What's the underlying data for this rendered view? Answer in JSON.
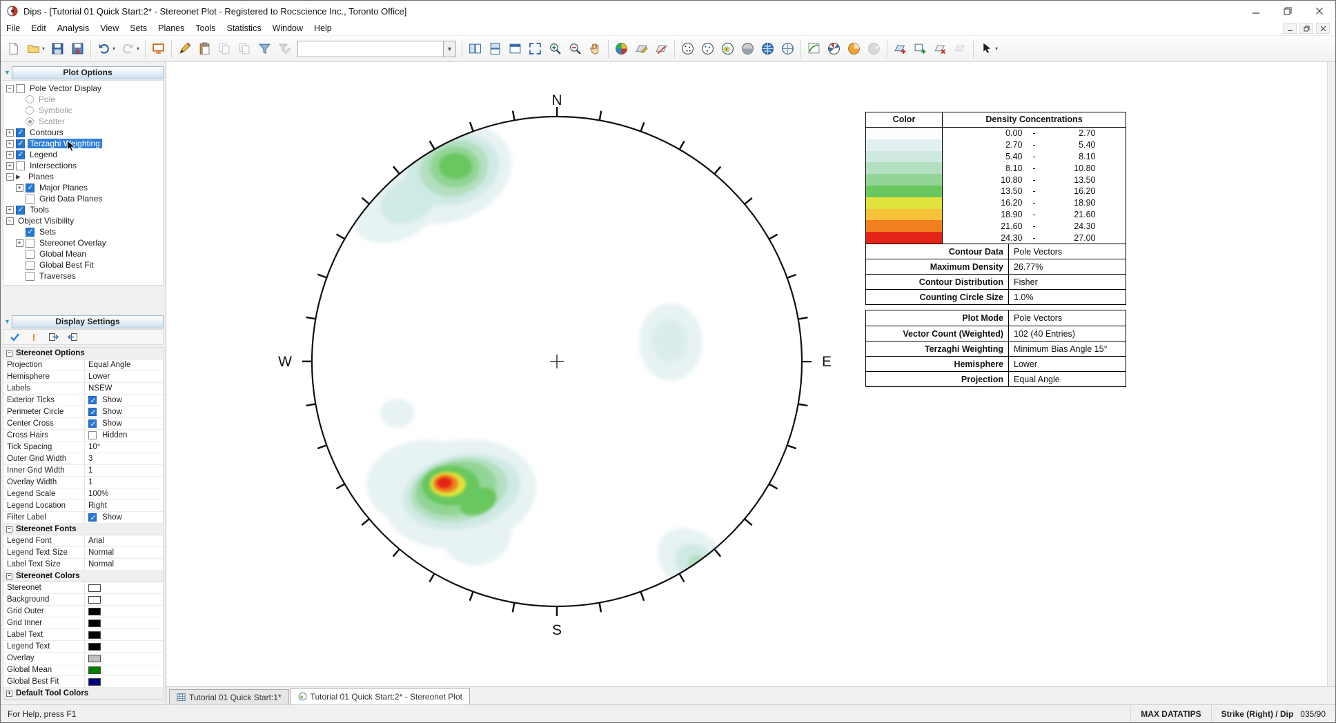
{
  "titlebar": {
    "title": "Dips - [Tutorial 01 Quick Start:2* - Stereonet Plot - Registered to Rocscience Inc., Toronto Office]"
  },
  "menubar": {
    "items": [
      "File",
      "Edit",
      "Analysis",
      "View",
      "Sets",
      "Planes",
      "Tools",
      "Statistics",
      "Window",
      "Help"
    ]
  },
  "toolbar": {
    "combo_value": "",
    "icons": [
      "new-file",
      "open-folder",
      "save",
      "export-file",
      "undo",
      "redo",
      "presentation",
      "edit-pen",
      "paste",
      "copy",
      "duplicate",
      "filter",
      "filter-edit",
      "symbol-combo",
      "split-vertical",
      "split-horizontal",
      "new-view",
      "zoom-extents",
      "zoom-in",
      "zoom-out",
      "pan-hand",
      "stereo-sphere",
      "add-plane-tool",
      "measure-tool",
      "pole-plot",
      "scatter-plot",
      "contour-sphere",
      "gray-sphere",
      "blue-globe",
      "grid-globe",
      "chart-curve",
      "rosette-plot",
      "pie-chart",
      "pie-chart-secondary",
      "add-plane",
      "add-window",
      "delete-tool",
      "extra-tool",
      "select-arrow"
    ]
  },
  "plot_options": {
    "title": "Plot Options",
    "items": [
      {
        "label": "Pole Vector Display",
        "level": 0,
        "expander": "minus",
        "check": "unchecked"
      },
      {
        "label": "Pole",
        "level": 1,
        "radio": "off",
        "disabled": true
      },
      {
        "label": "Symbolic",
        "level": 1,
        "radio": "off",
        "disabled": true
      },
      {
        "label": "Scatter",
        "level": 1,
        "radio": "on",
        "disabled": true
      },
      {
        "label": "Contours",
        "level": 0,
        "expander": "plus",
        "check": "checked"
      },
      {
        "label": "Terzaghi Weighting",
        "level": 0,
        "expander": "plus",
        "check": "checked",
        "selected": true
      },
      {
        "label": "Legend",
        "level": 0,
        "expander": "plus",
        "check": "checked"
      },
      {
        "label": "Intersections",
        "level": 0,
        "expander": "plus",
        "check": "unchecked"
      },
      {
        "label": "Planes",
        "level": 0,
        "expander": "minus"
      },
      {
        "label": "Major Planes",
        "level": 1,
        "expander": "plus",
        "check": "checked"
      },
      {
        "label": "Grid Data Planes",
        "level": 1,
        "check": "unchecked"
      },
      {
        "label": "Tools",
        "level": 0,
        "expander": "plus",
        "check": "checked"
      },
      {
        "label": "Object Visibility",
        "level": 0,
        "expander": "minus"
      },
      {
        "label": "Sets",
        "level": 1,
        "check": "checked"
      },
      {
        "label": "Stereonet Overlay",
        "level": 1,
        "expander": "plus",
        "check": "unchecked"
      },
      {
        "label": "Global Mean",
        "level": 1,
        "check": "unchecked"
      },
      {
        "label": "Global Best Fit",
        "level": 1,
        "check": "unchecked"
      },
      {
        "label": "Traverses",
        "level": 1,
        "check": "unchecked"
      }
    ]
  },
  "display_settings": {
    "title": "Display Settings",
    "rows": [
      {
        "type": "section",
        "label": "Stereonet Options"
      },
      {
        "label": "Projection",
        "value": "Equal Angle"
      },
      {
        "label": "Hemisphere",
        "value": "Lower"
      },
      {
        "label": "Labels",
        "value": "NSEW"
      },
      {
        "label": "Exterior Ticks",
        "value": "Show",
        "check": "checked"
      },
      {
        "label": "Perimeter Circle",
        "value": "Show",
        "check": "checked"
      },
      {
        "label": "Center Cross",
        "value": "Show",
        "check": "checked"
      },
      {
        "label": "Cross Hairs",
        "value": "Hidden",
        "check": "unchecked"
      },
      {
        "label": "Tick Spacing",
        "value": "10°"
      },
      {
        "label": "Outer Grid Width",
        "value": "3"
      },
      {
        "label": "Inner Grid Width",
        "value": "1"
      },
      {
        "label": "Overlay Width",
        "value": "1"
      },
      {
        "label": "Legend Scale",
        "value": "100%"
      },
      {
        "label": "Legend Location",
        "value": "Right"
      },
      {
        "label": "Filter Label",
        "value": "Show",
        "check": "checked"
      },
      {
        "type": "section",
        "label": "Stereonet Fonts"
      },
      {
        "label": "Legend Font",
        "value": "Arial"
      },
      {
        "label": "Legend Text Size",
        "value": "Normal"
      },
      {
        "label": "Label Text Size",
        "value": "Normal"
      },
      {
        "type": "section",
        "label": "Stereonet Colors"
      },
      {
        "label": "Stereonet",
        "swatch": "#ffffff"
      },
      {
        "label": "Background",
        "swatch": "#ffffff"
      },
      {
        "label": "Grid Outer",
        "swatch": "#000000"
      },
      {
        "label": "Grid Inner",
        "swatch": "#000000"
      },
      {
        "label": "Label Text",
        "swatch": "#000000"
      },
      {
        "label": "Legend Text",
        "swatch": "#000000"
      },
      {
        "label": "Overlay",
        "swatch": "#c0c0c0"
      },
      {
        "label": "Global Mean",
        "swatch": "#008000"
      },
      {
        "label": "Global Best Fit",
        "swatch": "#000080"
      },
      {
        "type": "section",
        "label": "Default Tool Colors"
      }
    ]
  },
  "stereonet": {
    "north": "N",
    "east": "E",
    "south": "S",
    "west": "W"
  },
  "legend": {
    "headers": {
      "color": "Color",
      "density": "Density Concentrations"
    },
    "dash": "-",
    "bands": [
      {
        "from": "0.00",
        "to": "2.70",
        "color": "#fdfefe"
      },
      {
        "from": "2.70",
        "to": "5.40",
        "color": "#e3f0f2"
      },
      {
        "from": "5.40",
        "to": "8.10",
        "color": "#cfe9e2"
      },
      {
        "from": "8.10",
        "to": "10.80",
        "color": "#b4dfc0"
      },
      {
        "from": "10.80",
        "to": "13.50",
        "color": "#92d596"
      },
      {
        "from": "13.50",
        "to": "16.20",
        "color": "#69c75f"
      },
      {
        "from": "16.20",
        "to": "18.90",
        "color": "#e0e33c"
      },
      {
        "from": "18.90",
        "to": "21.60",
        "color": "#f6c23a"
      },
      {
        "from": "21.60",
        "to": "24.30",
        "color": "#f2801e"
      },
      {
        "from": "24.30",
        "to": "27.00",
        "color": "#e32417"
      }
    ],
    "info_rows": [
      {
        "label": "Contour Data",
        "value": "Pole Vectors"
      },
      {
        "label": "Maximum Density",
        "value": "26.77%"
      },
      {
        "label": "Contour Distribution",
        "value": "Fisher"
      },
      {
        "label": "Counting Circle Size",
        "value": "1.0%"
      }
    ],
    "plot_rows": [
      {
        "label": "Plot Mode",
        "value": "Pole Vectors"
      },
      {
        "label": "Vector Count (Weighted)",
        "value": "102 (40 Entries)"
      },
      {
        "label": "Terzaghi Weighting",
        "value": "Minimum Bias Angle 15°"
      },
      {
        "label": "Hemisphere",
        "value": "Lower"
      },
      {
        "label": "Projection",
        "value": "Equal Angle"
      }
    ]
  },
  "document_tabs": [
    {
      "label": "Tutorial 01 Quick Start:1*",
      "active": false
    },
    {
      "label": "Tutorial 01 Quick Start:2* - Stereonet Plot",
      "active": true
    }
  ],
  "status_bar": {
    "message": "For Help, press F1",
    "max_datatips": "MAX DATATIPS",
    "orientation_label": "Strike (Right) / Dip",
    "orientation_value": "035/90"
  }
}
